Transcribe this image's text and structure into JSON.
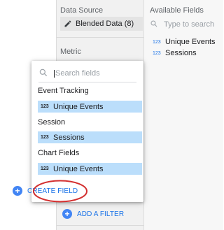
{
  "data_panel": {
    "data_source_label": "Data Source",
    "data_source_value": "Blended Data (8)",
    "metric_label": "Metric"
  },
  "available_fields": {
    "title": "Available Fields",
    "search_placeholder": "Type to search",
    "items": [
      {
        "badge": "123",
        "name": "Unique Events"
      },
      {
        "badge": "123",
        "name": "Sessions"
      }
    ]
  },
  "field_picker": {
    "search_placeholder": "Search fields",
    "groups": [
      {
        "label": "Event Tracking",
        "field": {
          "badge": "123",
          "name": "Unique Events"
        }
      },
      {
        "label": "Session",
        "field": {
          "badge": "123",
          "name": "Sessions"
        }
      },
      {
        "label": "Chart Fields",
        "field": {
          "badge": "123",
          "name": "Unique Events"
        }
      }
    ],
    "create_field_label": "CREATE FIELD"
  },
  "add_filter_label": "ADD A FILTER",
  "colors": {
    "accent_blue": "#4285f4",
    "link_blue": "#1a73e8",
    "chip_blue": "#bbdefb",
    "annotation_red": "#d32f2f"
  },
  "icons": [
    "pencil-icon",
    "search-icon",
    "plus-circle-icon"
  ]
}
